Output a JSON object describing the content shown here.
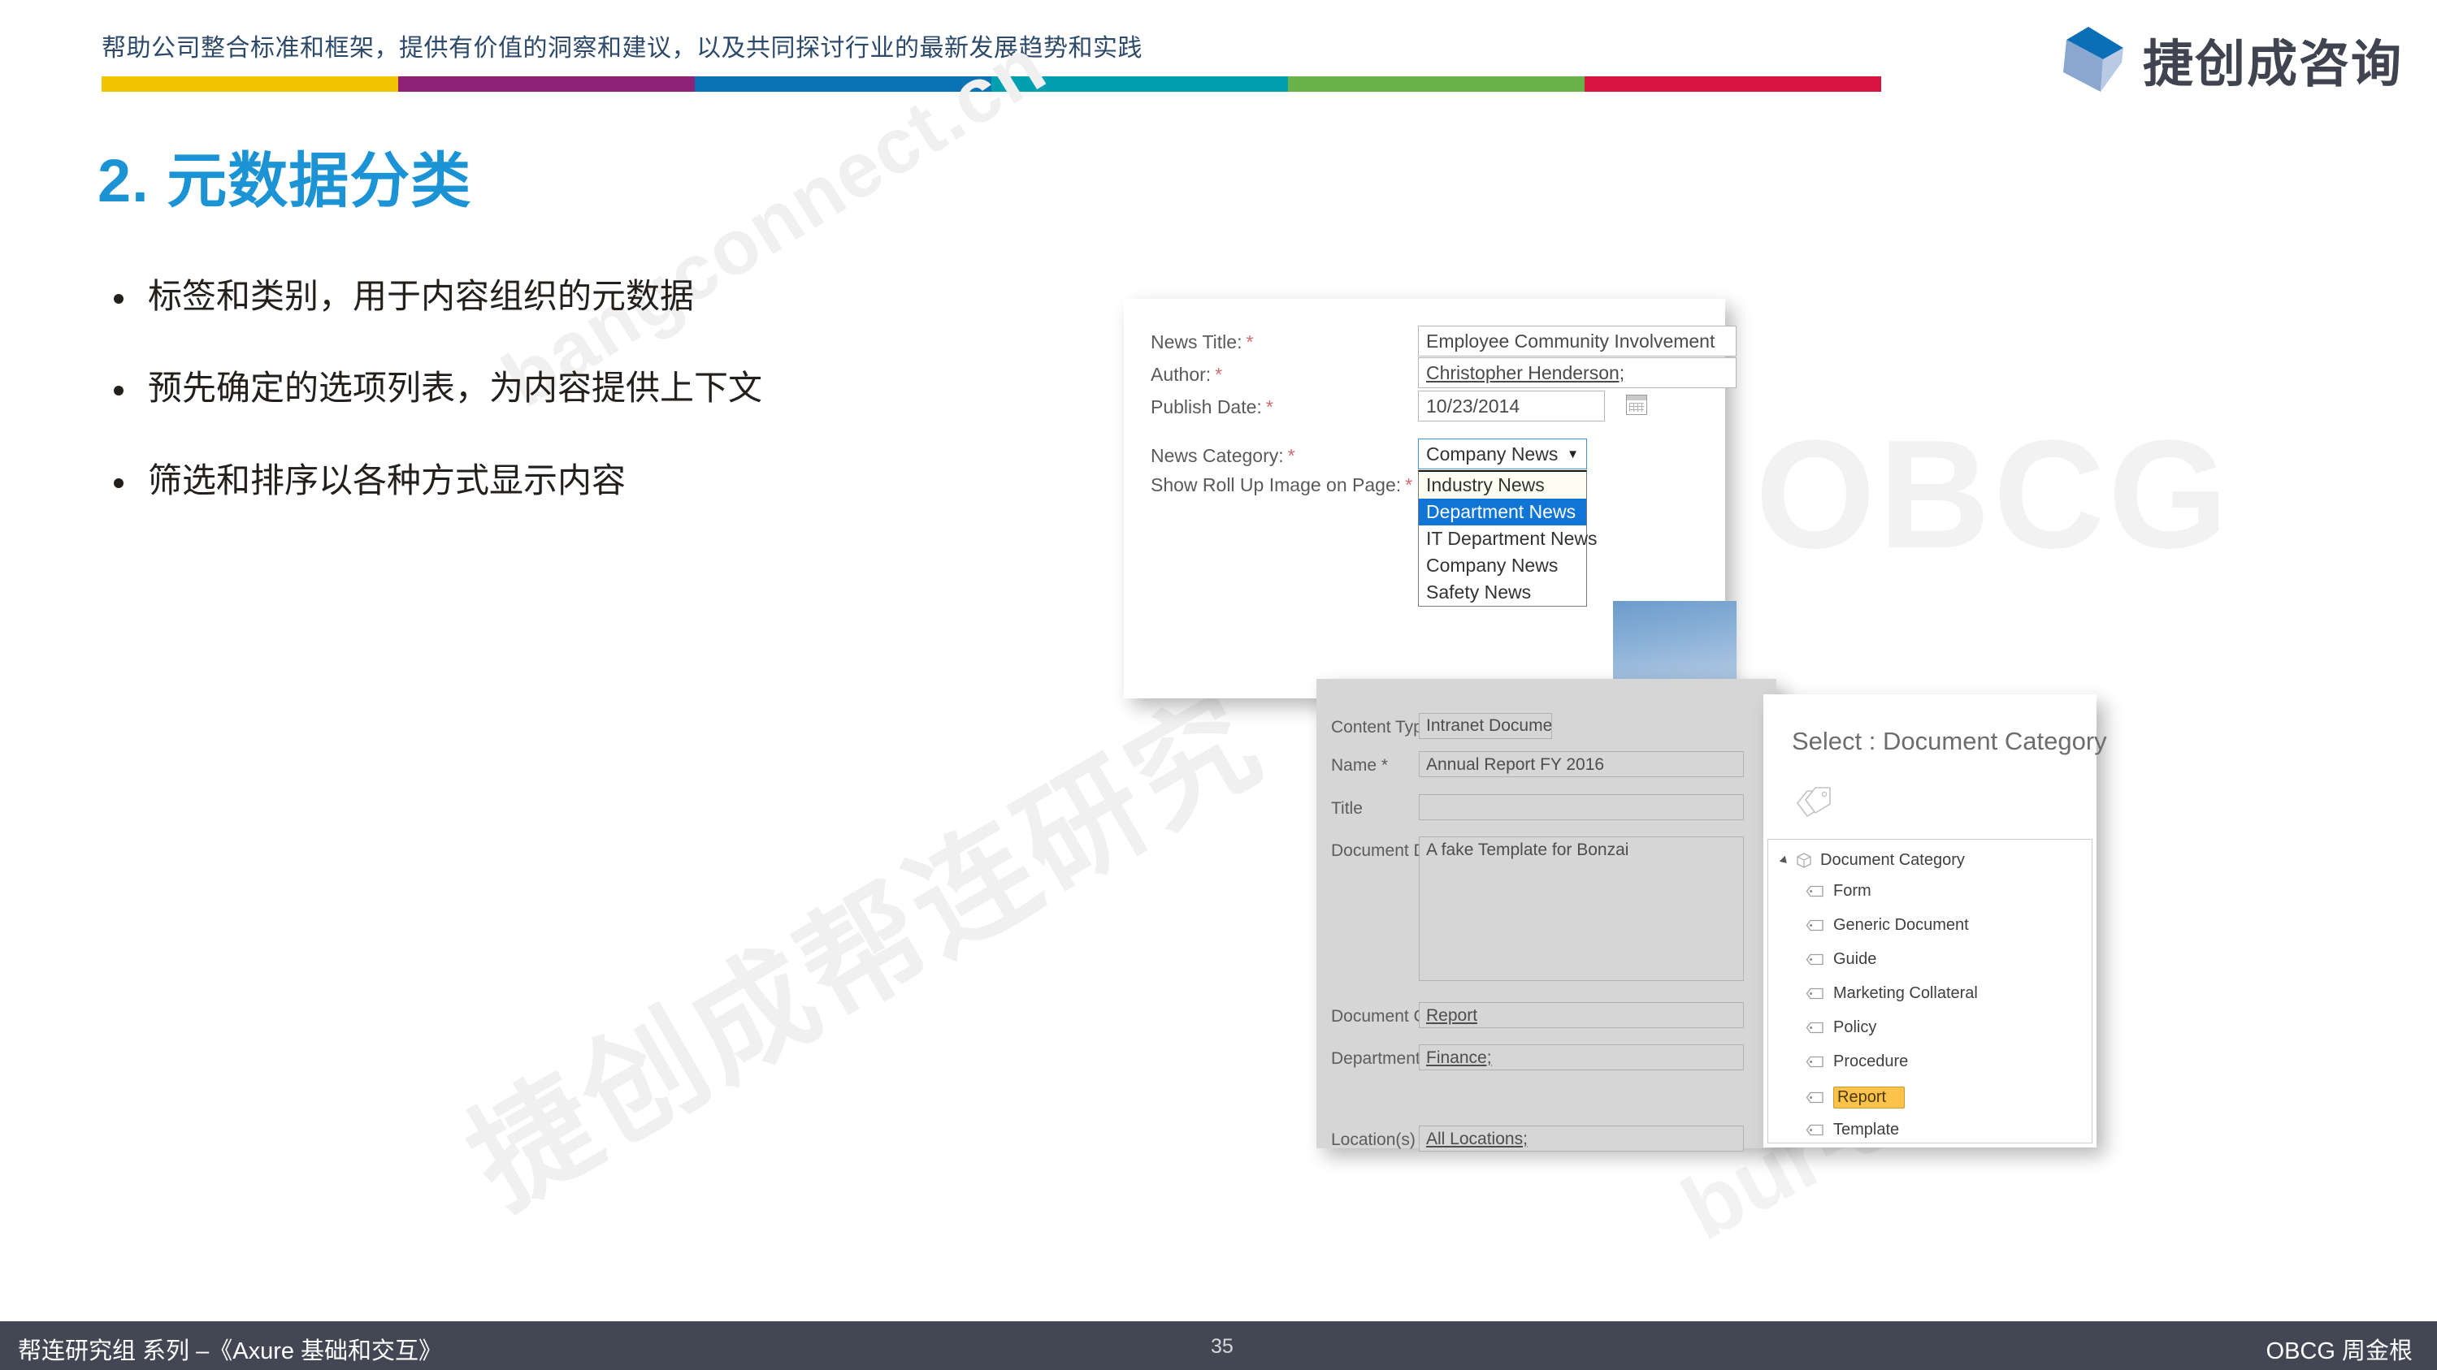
{
  "header": {
    "tagline": "帮助公司整合标准和框架，提供有价值的洞察和建议，以及共同探讨行业的最新发展趋势和实践",
    "color_bar": [
      {
        "name": "yellow",
        "color": "#f0c400",
        "flex": 1.0
      },
      {
        "name": "magenta",
        "color": "#8f2277",
        "flex": 1.0
      },
      {
        "name": "blue",
        "color": "#0b72b5",
        "flex": 1.0
      },
      {
        "name": "teal",
        "color": "#00a0b0",
        "flex": 1.0
      },
      {
        "name": "green",
        "color": "#6ab34a",
        "flex": 1.0
      },
      {
        "name": "red",
        "color": "#d81440",
        "flex": 1.0
      }
    ],
    "logo_text": "捷创成咨询",
    "logo_colors": {
      "dark_blue": "#0b6fb8",
      "mid_blue": "#8aa8cf",
      "light_blue": "#b9cbe4"
    }
  },
  "title": {
    "text": "2. 元数据分类",
    "color": "#1c93d4"
  },
  "bullets": [
    {
      "text": "标签和类别，用于内容组织的元数据"
    },
    {
      "text": "预先确定的选项列表，为内容提供上下文"
    },
    {
      "text": "筛选和排序以各种方式显示内容"
    }
  ],
  "watermarks": {
    "url": "bangconnect.cn",
    "chinese": "捷创成帮连研究",
    "obcg": "OBCG",
    "bottom": "bur-s"
  },
  "news_panel": {
    "fields": [
      {
        "label": "News Title:",
        "required": "*",
        "value": "Employee Community Involvement"
      },
      {
        "label": "Author:",
        "required": "*",
        "value": "Christopher Henderson;"
      },
      {
        "label": "Publish Date:",
        "required": "*",
        "value": "10/23/2014"
      }
    ],
    "category_label": "News Category:",
    "category_required": "*",
    "category_value": "Company News",
    "rollup_label": "Show Roll Up Image on Page:",
    "rollup_required": "*",
    "dropdown_options": [
      "Industry News",
      "Department News",
      "IT Department News",
      "Company News",
      "Safety News"
    ],
    "dropdown_selected": "Department News",
    "caret": "▼",
    "calendar_icon": "calendar-icon"
  },
  "doc_panel": {
    "rows": [
      {
        "label": "Content Type",
        "value": "Intranet Document",
        "type": "combo"
      },
      {
        "label": "Name *",
        "value": "Annual Report FY 2016",
        "type": "text"
      },
      {
        "label": "Title",
        "value": "",
        "type": "text"
      },
      {
        "label": "Document Description",
        "value": "A fake Template for Bonzai",
        "type": "textarea"
      },
      {
        "label": "Document Category",
        "value": "Report",
        "type": "link"
      },
      {
        "label": "Department(s)",
        "value": "Finance;",
        "type": "link"
      },
      {
        "label": "Location(s)",
        "value": "All Locations;",
        "type": "link"
      }
    ],
    "caret": "▼"
  },
  "select_panel": {
    "title": "Select : Document Category",
    "header_icon": "tags-icon",
    "tree_root": "Document Category",
    "root_icon": "stack-icon",
    "expand_icon": "expand-triangle-icon",
    "items": [
      {
        "label": "Form",
        "selected": false
      },
      {
        "label": "Generic Document",
        "selected": false
      },
      {
        "label": "Guide",
        "selected": false
      },
      {
        "label": "Marketing Collateral",
        "selected": false
      },
      {
        "label": "Policy",
        "selected": false
      },
      {
        "label": "Procedure",
        "selected": false
      },
      {
        "label": "Report",
        "selected": true
      },
      {
        "label": "Template",
        "selected": false
      }
    ],
    "highlight_color": "#fcc24a"
  },
  "footer": {
    "left": "帮连研究组 系列 –《Axure 基础和交互》",
    "page": "35",
    "right": "OBCG 周金根",
    "bg": "#434754"
  }
}
